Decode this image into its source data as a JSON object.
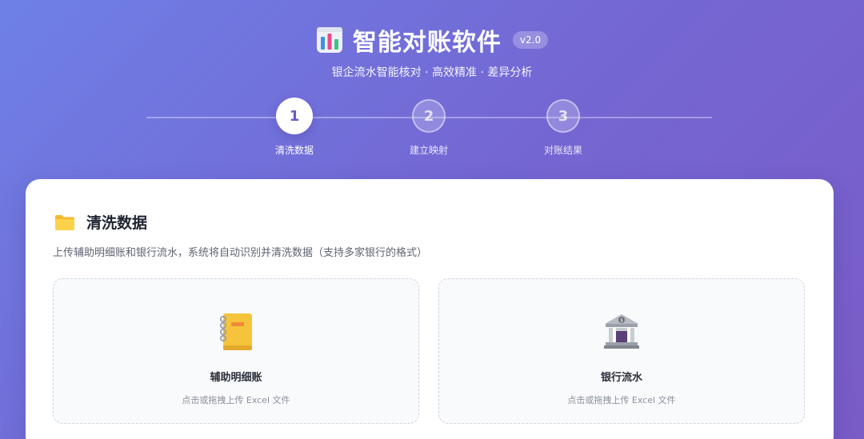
{
  "header": {
    "app_icon": "bar-chart-icon",
    "title": "智能对账软件",
    "version": "v2.0",
    "subtitle": "银企流水智能核对 · 高效精准 · 差异分析"
  },
  "stepper": {
    "steps": [
      {
        "number": "1",
        "label": "清洗数据",
        "state": "active"
      },
      {
        "number": "2",
        "label": "建立映射",
        "state": "inactive"
      },
      {
        "number": "3",
        "label": "对账结果",
        "state": "inactive"
      }
    ]
  },
  "section": {
    "icon": "folder-icon",
    "title": "清洗数据",
    "description": "上传辅助明细账和银行流水，系统将自动识别并清洗数据（支持多家银行的格式）"
  },
  "uploads": [
    {
      "icon": "notebook-icon",
      "title": "辅助明细账",
      "hint": "点击或拖拽上传 Excel 文件"
    },
    {
      "icon": "bank-icon",
      "title": "银行流水",
      "hint": "点击或拖拽上传 Excel 文件"
    }
  ],
  "colors": {
    "gradient_start": "#6e80e6",
    "gradient_end": "#7a5cc7",
    "accent": "#6a59c9"
  }
}
